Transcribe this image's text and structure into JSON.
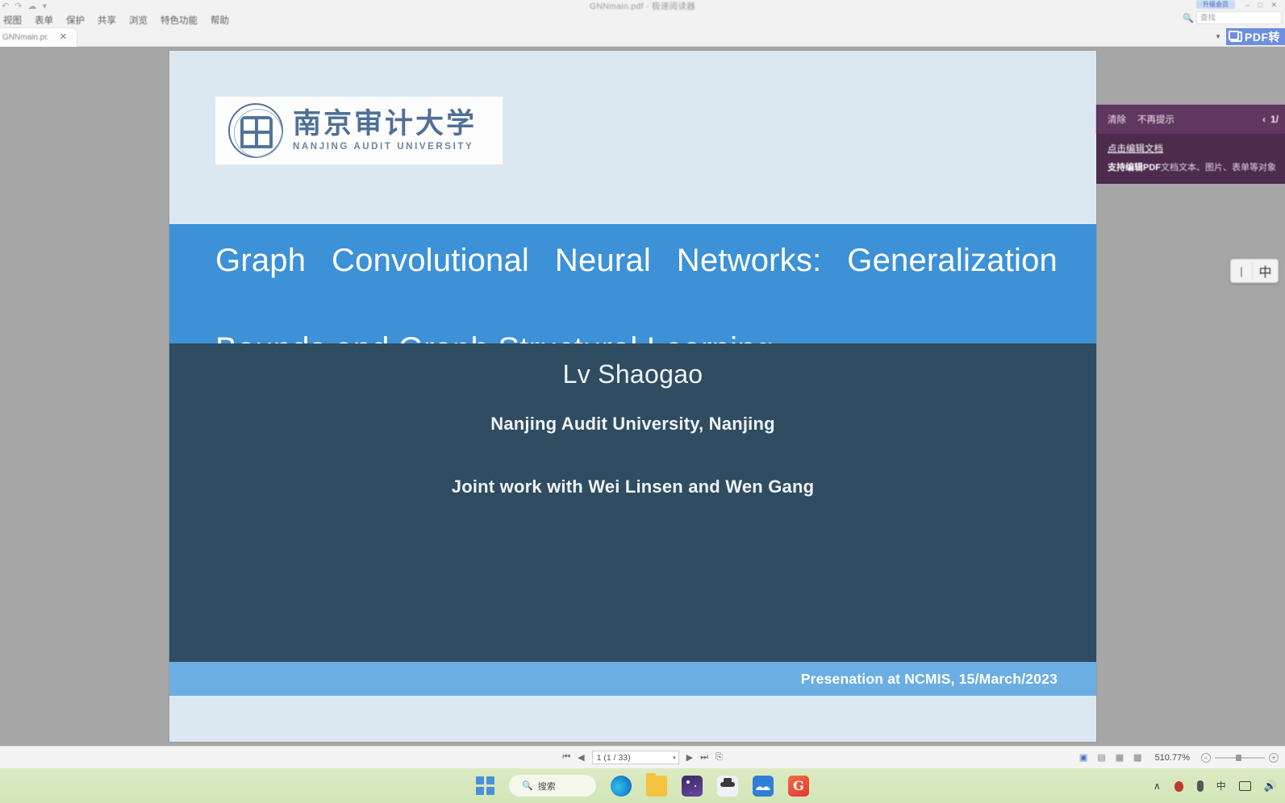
{
  "window": {
    "title": "GNNmain.pdf - 极速阅读器",
    "quick_access_icons": [
      "undo-icon",
      "redo-icon",
      "cloud-icon",
      "dropdown-icon"
    ],
    "menu_items": [
      "视图",
      "表单",
      "保护",
      "共享",
      "浏览",
      "特色功能",
      "帮助"
    ],
    "tab_label": "GNNmain.pdf",
    "tab_close": "✕",
    "member_button": "升级会员",
    "window_controls": "– □ ✕",
    "search_icon": "search-icon",
    "search_value": "查找",
    "pdf_button": "PDF转",
    "pdf_dropdown_caret": "▼"
  },
  "promo": {
    "clear_label": "清除",
    "dismiss_label": "不再提示",
    "prev_arrow": "‹",
    "counter": "1/",
    "link": "点击编辑文档",
    "desc_bold": "支持编辑PDF",
    "desc_rest": "文档文本、图片、表单等对象"
  },
  "ime": {
    "bar": "|",
    "mode": "中"
  },
  "slide": {
    "logo": {
      "cn": "南京审计大学",
      "en": "NANJING  AUDIT  UNIVERSITY",
      "seal": "university-seal-icon"
    },
    "title_line1": "Graph Convolutional Neural Networks: Generalization",
    "title_line2": "Bounds and Graph Structural Learning",
    "author": "Lv Shaogao",
    "affiliation": "Nanjing Audit University, Nanjing",
    "joint_work": "Joint work with Wei Linsen and Wen Gang",
    "footer": "Presenation at NCMIS, 15/March/2023",
    "colors": {
      "page_background": "#dce8f1",
      "title_band": "#3d91d7",
      "body_band": "#2f4c60",
      "footer_band": "#6aaee2",
      "logo_blue": "#4f6f96"
    }
  },
  "statusbar": {
    "first_page_icon": "first-page-icon",
    "prev_page_icon": "prev-page-icon",
    "page_value": "1 (1 / 33)",
    "page_dropdown_caret": "▾",
    "next_page_icon": "next-page-icon",
    "last_page_icon": "last-page-icon",
    "fit_page_icon": "fit-page-icon",
    "view_icons": [
      "single-page-icon",
      "continuous-scroll-icon",
      "two-page-icon",
      "facing-page-icon"
    ],
    "zoom_level": "510.77%",
    "zoom_out": "−",
    "zoom_in": "+"
  },
  "taskbar": {
    "start_icon": "windows-start-icon",
    "search_icon": "search-icon",
    "search_label": "搜索",
    "apps": [
      {
        "name": "edge-icon",
        "label": "Microsoft Edge"
      },
      {
        "name": "file-explorer-icon",
        "label": "文件资源管理器"
      },
      {
        "name": "store-icon",
        "label": "Microsoft Store"
      },
      {
        "name": "explorer-patch-icon",
        "label": "ExplorerPatcher"
      },
      {
        "name": "wechat-icon",
        "label": "微信"
      },
      {
        "name": "gitee-icon",
        "label": "G"
      }
    ],
    "tray": {
      "chevron": "∧",
      "qq_icon": "qq-icon",
      "mic_icon": "microphone-icon",
      "ime_label": "中",
      "network_icon": "network-icon",
      "volume_icon": "🔊"
    }
  }
}
